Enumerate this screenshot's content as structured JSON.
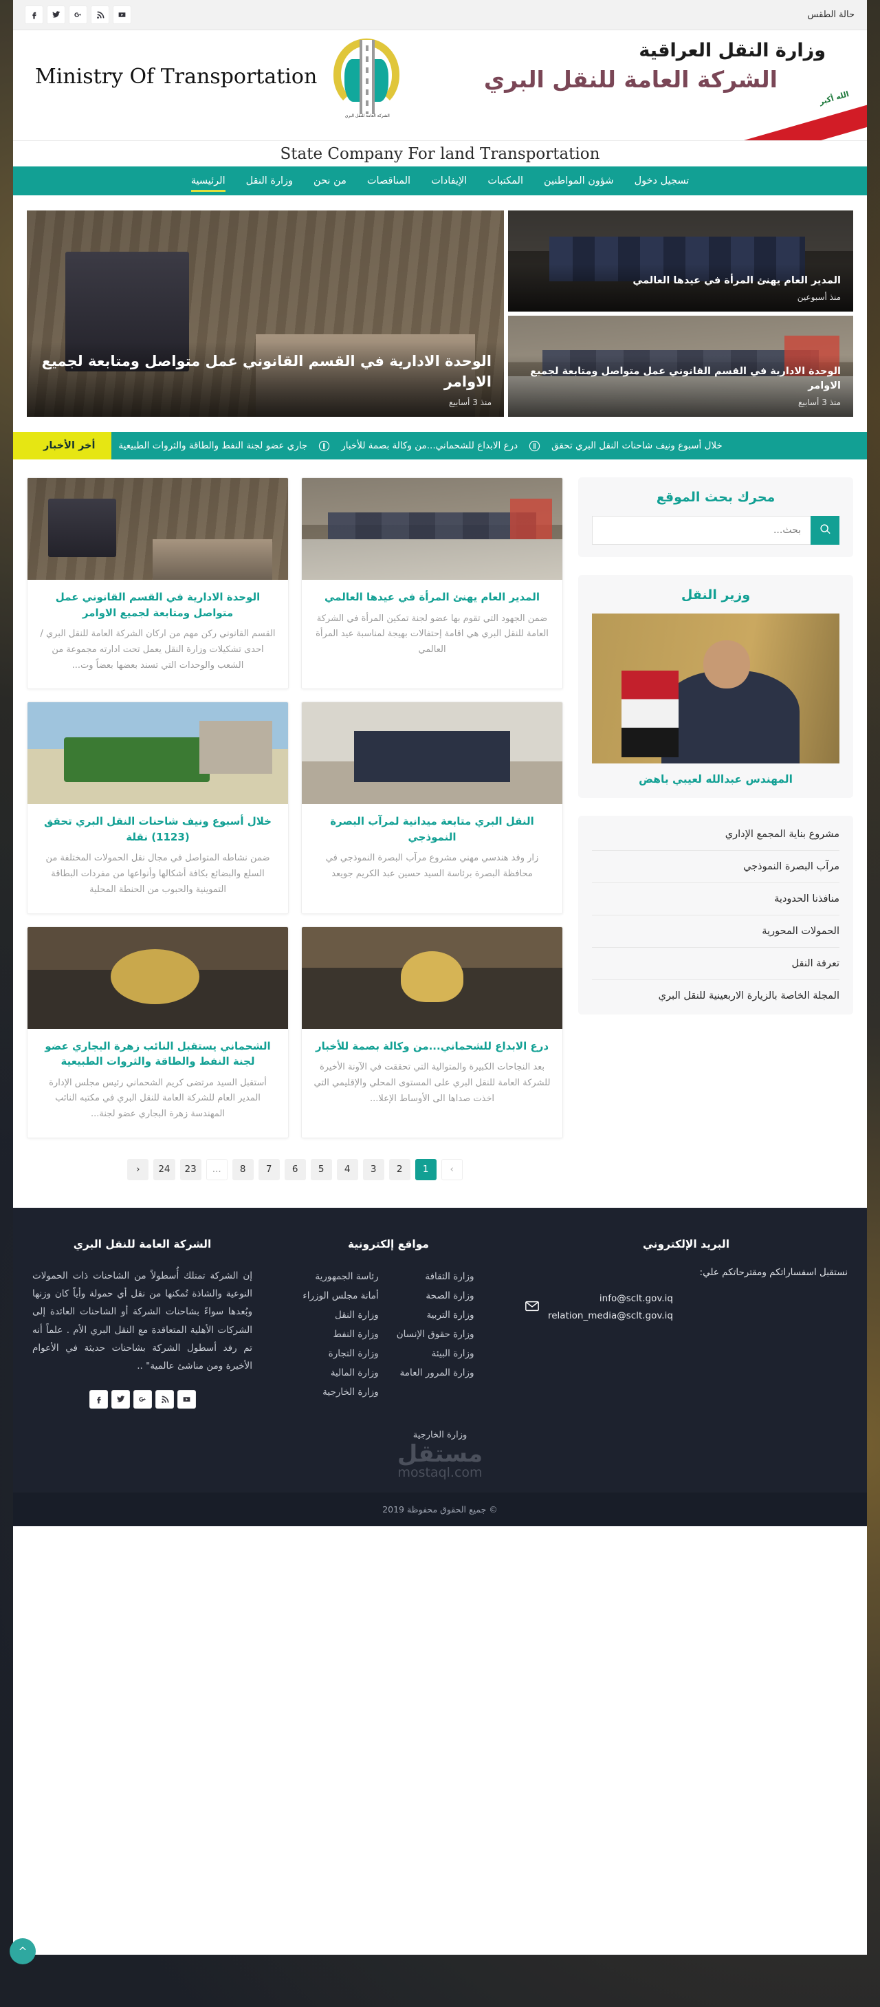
{
  "topbar": {
    "weather": "حالة الطقس",
    "social": [
      {
        "name": "facebook-icon",
        "glyph": "f"
      },
      {
        "name": "twitter-icon",
        "glyph": "t"
      },
      {
        "name": "google-plus-icon",
        "glyph": "G+"
      },
      {
        "name": "rss-icon",
        "glyph": "rss"
      },
      {
        "name": "youtube-icon",
        "glyph": "yt"
      }
    ]
  },
  "brand": {
    "english_name": "Ministry Of Transportation",
    "english_subtitle": "State Company For land Transportation",
    "arabic_ministry": "وزارة النقل العراقية",
    "arabic_company": "الشركة العامة للنقل البري",
    "flag_takbir": "الله أكبر",
    "emblem_arc": "الشركة العامة للنقل البري"
  },
  "nav": {
    "items": [
      {
        "label": "الرئيسية",
        "active": true
      },
      {
        "label": "وزارة النقل",
        "active": false
      },
      {
        "label": "من نحن",
        "active": false
      },
      {
        "label": "المناقصات",
        "active": false
      },
      {
        "label": "الإيفادات",
        "active": false
      },
      {
        "label": "المكتبات",
        "active": false
      },
      {
        "label": "شؤون المواطنين",
        "active": false
      },
      {
        "label": "تسجيل دخول",
        "active": false
      }
    ]
  },
  "hero": {
    "main": {
      "title": "الوحدة الادارية في القسم القانوني عمل متواصل ومتابعة لجميع الاوامر",
      "date": "منذ 3 أسابيع"
    },
    "side": [
      {
        "title": "المدير العام يهنئ المرأة في عيدها العالمي",
        "date": "منذ أسبوعين"
      },
      {
        "title": "الوحدة الادارية في القسم القانوني عمل متواصل ومتابعة لجميع الاوامر",
        "date": "منذ 3 أسابيع"
      }
    ]
  },
  "ticker": {
    "label": "أخر الأخبار",
    "items": [
      "خلال أسبوع ونيف شاحنات النقل البري تحقق",
      "درع الابداع للشحماني...من وكالة بصمة للأخبار",
      "جاري عضو لجنة النفط والطاقة والثروات الطبيعية"
    ]
  },
  "sidebar": {
    "search": {
      "title": "محرك بحث الموقع",
      "placeholder": "بحث...",
      "value": "",
      "button_icon": "search-icon"
    },
    "minister": {
      "title": "وزير النقل",
      "name": "المهندس عبدالله لعيبي باهض"
    },
    "links": [
      "مشروع بناية المجمع الإداري",
      "مرآب البصرة النموذجي",
      "منافذنا الحدودية",
      "الحمولات المحورية",
      "تعرفة النقل",
      "المجلة الخاصة بالزيارة الاربعينية للنقل البري"
    ]
  },
  "news": {
    "cards": [
      {
        "thumb": "ph-desk",
        "title": "المدير العام يهنئ المرأة في عيدها العالمي",
        "excerpt": "ضمن الجهود التي تقوم بها عضو لجنة تمكين المرأة في الشركة العامة للنقل البري هي اقامة إحتفالات بهيجة لمناسبة عيد المرأة العالمي"
      },
      {
        "thumb": "ph-office",
        "title": "الوحدة الادارية في القسم القانوني عمل متواصل ومتابعة لجميع الاوامر",
        "excerpt": "القسم القانوني ركن مهم من اركان الشركة العامة للنقل البري / احدى تشكيلات وزارة النقل يعمل تحت ادارته مجموعة من الشعب والوحدات التي تسند بعضها بعضاً وت..."
      },
      {
        "thumb": "ph-plan",
        "title": "النقل البري متابعة ميدانية لمرآب البصرة النموذجي",
        "excerpt": "زار وفد هندسي مهني مشروع مرآب البصرة النموذجي في محافظة البصرة برئاسة السيد حسين عبد الكريم جويعد"
      },
      {
        "thumb": "ph-truck",
        "title": "خلال أسبوع ونيف شاحنات النقل البري تحقق (1123) نقلة",
        "excerpt": "ضمن نشاطه المتواصل في مجال نقل الحمولات المختلفة من السلع والبضائع بكافة أشكالها وأنواعها من مفردات البطاقة التموينية والحبوب من الحنطة المحلية"
      },
      {
        "thumb": "ph-trophy",
        "title": "درع الابداع للشحماني...من وكالة بصمة للأخبار",
        "excerpt": "بعد النجاحات الكبيرة والمتوالية التي تحققت في الآونة الأخيرة للشركة العامة للنقل البري على المستوى المحلي والإقليمي التي اخذت صداها الى الأوساط الإعلا..."
      },
      {
        "thumb": "ph-award",
        "title": "الشحماني يستقبل النائب زهرة البجاري عضو لجنة النفط والطاقة والثروات الطبيعية",
        "excerpt": "أستقبل السيد مرتضى كريم الشحماني رئيس مجلس الإدارة المدير العام للشركة العامة للنقل البري في مكتبه النائب المهندسة زهرة البجاري عضو لجنة..."
      }
    ]
  },
  "pagination": {
    "prev": "‹",
    "next": "›",
    "ellipsis": "...",
    "pages": [
      "24",
      "23",
      "8",
      "7",
      "6",
      "5",
      "4",
      "3",
      "2",
      "1"
    ],
    "current": "1"
  },
  "footer": {
    "about": {
      "title": "الشركة العامة للنقل البري",
      "text": "إن الشركة تمتلك أُسطولاً من الشاحنات ذات الحمولات النوعية والشاذة تُمكنها من نقل أي حمولة وأياً كان وزنها وبُعدها سواءً بشاحنات الشركة أو الشاحنات العائدة إلى الشركات الأهلية المتعاقدة مع النقل البري الأم . علماً أنه تم رفد أسطول الشركة بشاحنات حديثة في الأعوام الأخيرة ومن مناشئ عالمية\" ..",
      "social": [
        {
          "name": "facebook-icon",
          "glyph": "f"
        },
        {
          "name": "twitter-icon",
          "glyph": "t"
        },
        {
          "name": "google-plus-icon",
          "glyph": "G+"
        },
        {
          "name": "rss-icon",
          "glyph": "rss"
        },
        {
          "name": "youtube-icon",
          "glyph": "yt"
        }
      ]
    },
    "links": {
      "title": "مواقع إلكترونية",
      "col_a": [
        "رئاسة الجمهورية",
        "أمانة مجلس الوزراء",
        "وزارة النقل",
        "وزارة النفط",
        "وزارة التجارة",
        "وزارة المالية",
        "وزارة الخارجية"
      ],
      "col_b": [
        "وزارة الثقافة",
        "وزارة الصحة",
        "وزارة التربية",
        "وزارة حقوق الإنسان",
        "وزارة البيئة",
        "وزارة المرور العامة"
      ]
    },
    "mail": {
      "title": "البريد الإلكتروني",
      "lead": "نستقبل اسفساراتكم ومقترحاتكم علي:",
      "addresses": [
        "info@sclt.gov.iq",
        "relation_media@sclt.gov.iq"
      ],
      "icon": "envelope-icon"
    },
    "watermark": {
      "arabic": "مستقل",
      "latin": "mostaql.com"
    },
    "copyright": "© جميع الحقوق محفوظة 2019",
    "to_top_icon": "chevron-up-icon"
  },
  "theme": {
    "accent": "#12a094",
    "accent_yellow": "#e6e613",
    "footer_bg": "#1d222e",
    "card_bg": "#f7f7f8"
  }
}
